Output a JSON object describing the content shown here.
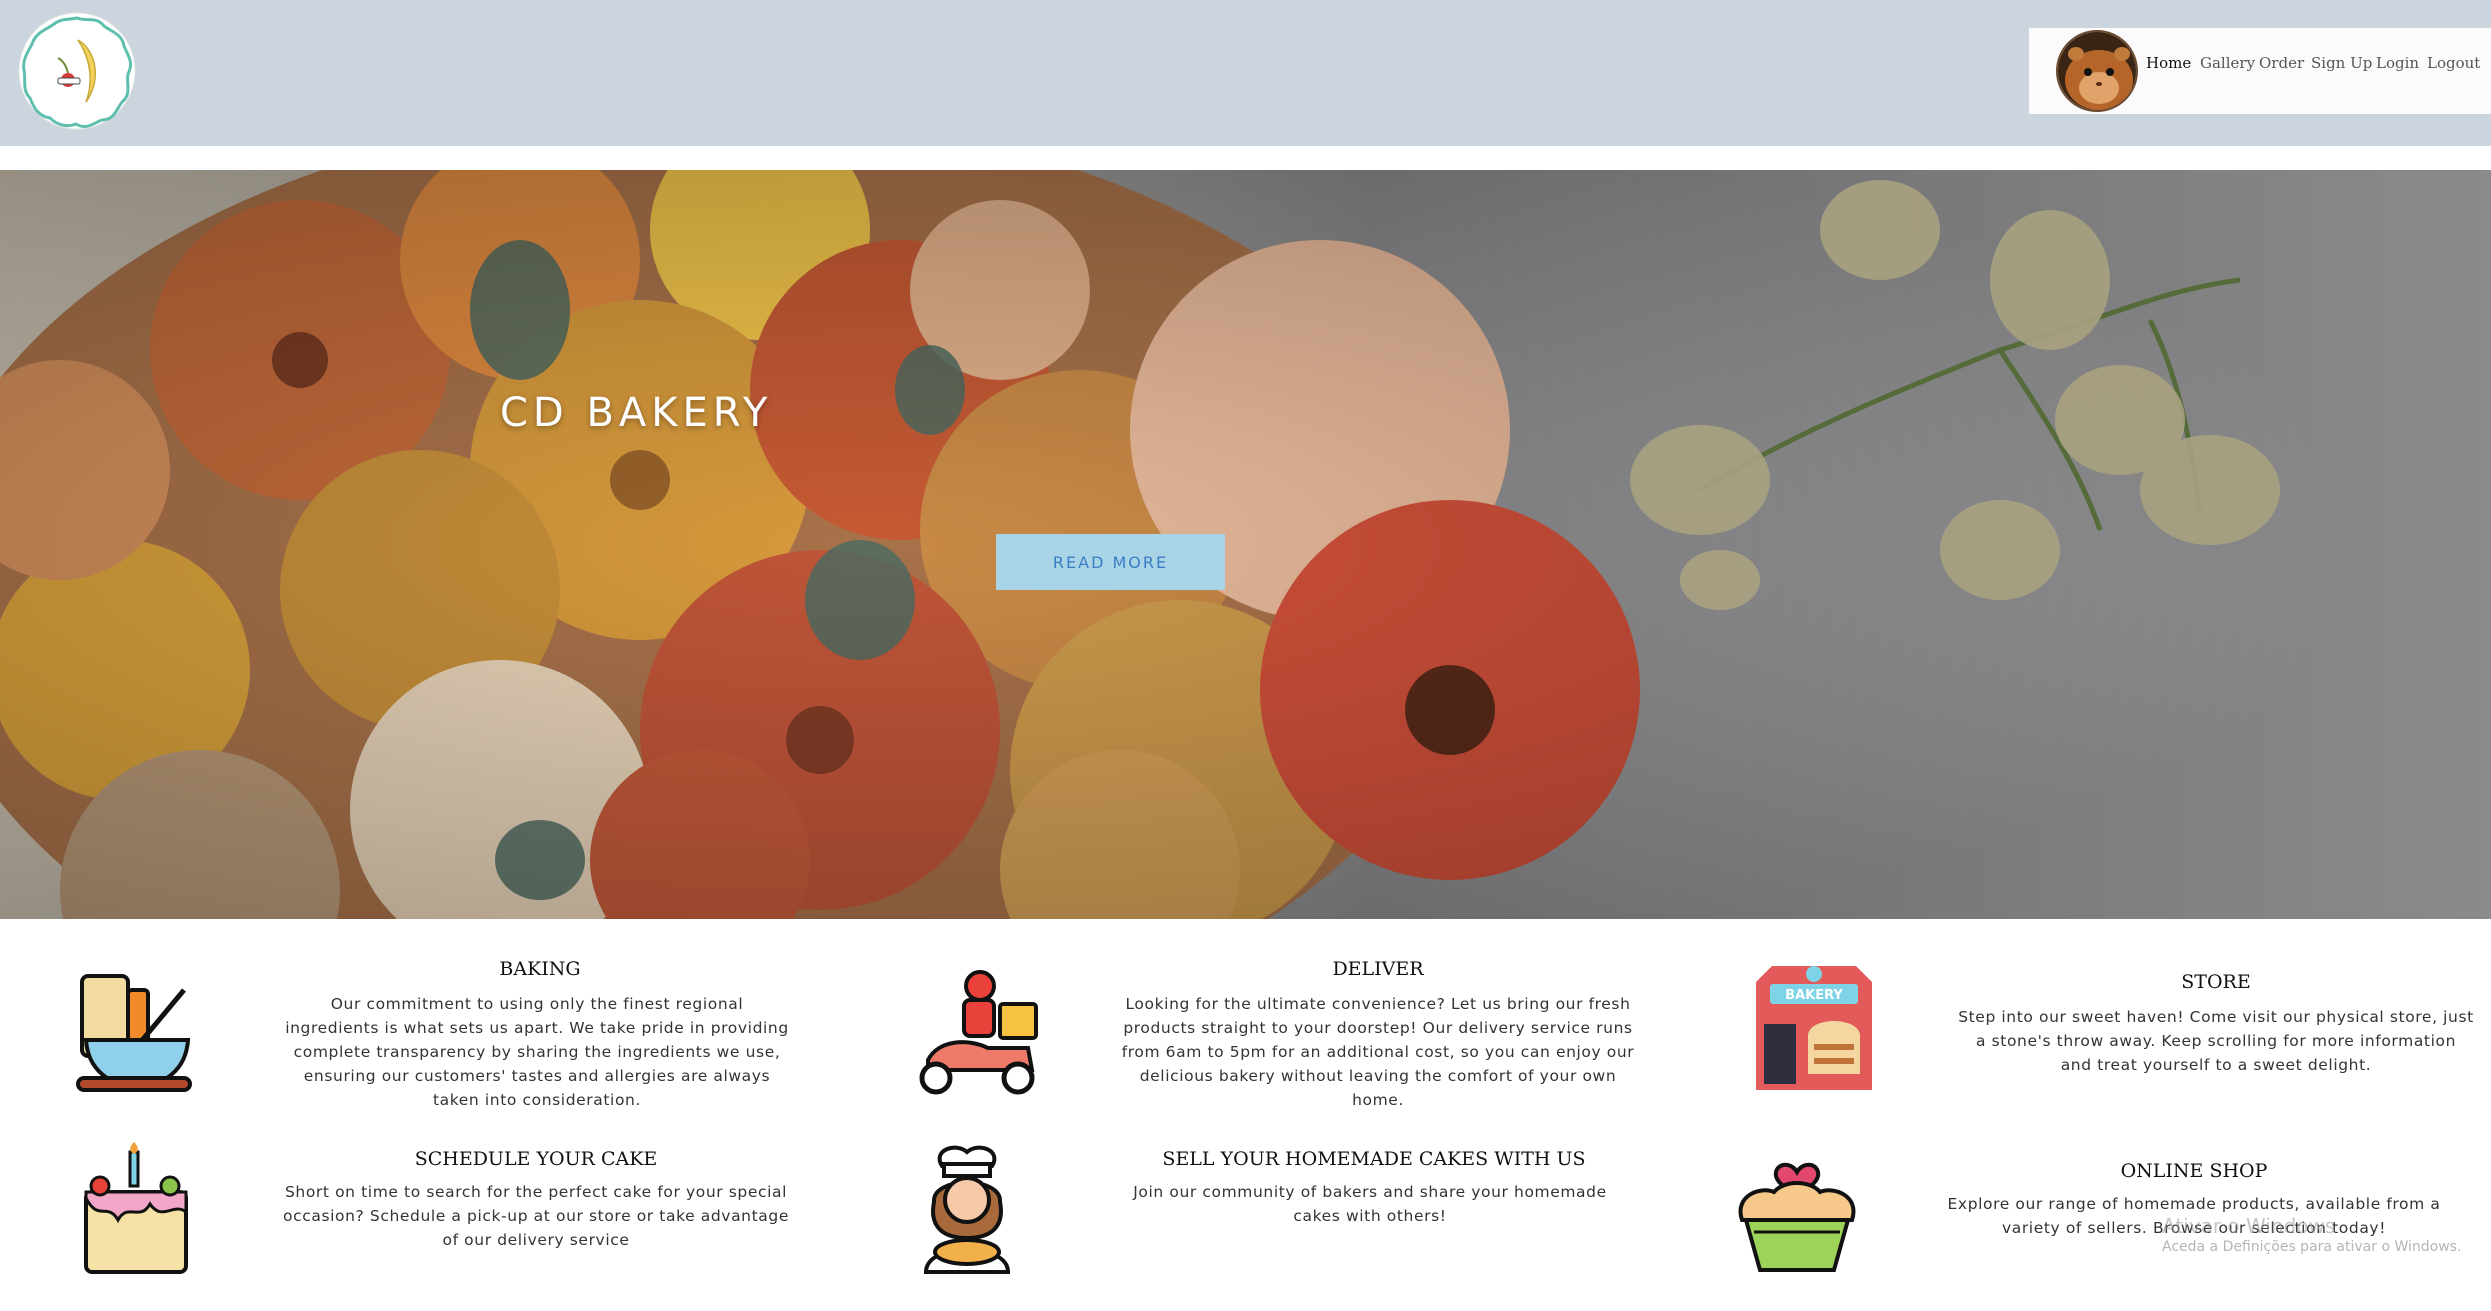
{
  "header": {
    "logo_icon": "bakery-logo-badge",
    "avatar_icon": "hamster-avatar",
    "nav": {
      "home": "Home",
      "gallery": "Gallery",
      "order": "Order",
      "signup": "Sign Up",
      "login": "Login",
      "logout": "Logout"
    }
  },
  "hero": {
    "title": "CD BAKERY",
    "button": "READ MORE",
    "image": "buttercream-flower-cake"
  },
  "features": {
    "baking": {
      "icon": "mixing-bowl-icon",
      "title": "BAKING",
      "text": "Our commitment to using only the finest regional ingredients is what sets us apart. We take pride in providing complete transparency by sharing the ingredients we use, ensuring our customers' tastes and allergies are always taken into consideration."
    },
    "deliver": {
      "icon": "delivery-scooter-icon",
      "title": "DELIVER",
      "text": "Looking for the ultimate convenience? Let us bring our fresh products straight to your doorstep! Our delivery service runs from 6am to 5pm for an additional cost, so you can enjoy our delicious bakery without leaving the comfort of your own home."
    },
    "store": {
      "icon": "bakery-store-icon",
      "icon_label": "BAKERY",
      "title": "STORE",
      "text": "Step into our sweet haven! Come visit our physical store, just a stone's throw away. Keep scrolling for more information and treat yourself to a sweet delight."
    },
    "schedule": {
      "icon": "birthday-cake-icon",
      "title": "SCHEDULE YOUR CAKE",
      "text": "Short on time to search for the perfect cake for your special occasion? Schedule a pick-up at our store or take advantage of our delivery service"
    },
    "sell": {
      "icon": "baker-woman-icon",
      "title": "SELL YOUR HOMEMADE CAKES WITH US",
      "text": "Join our community of bakers and share your homemade cakes with others!"
    },
    "shop": {
      "icon": "cupcake-icon",
      "title": "ONLINE SHOP",
      "text": "Explore our range of homemade products, available from a variety of sellers. Browse our selection today!"
    }
  },
  "watermark": {
    "line1": "Ativar o Windows",
    "line2": "Aceda a Definições para ativar o Windows."
  },
  "colors": {
    "header_bg": "#ccd4dd",
    "button_bg": "#a9d4e6",
    "button_text": "#3a7dc4"
  }
}
